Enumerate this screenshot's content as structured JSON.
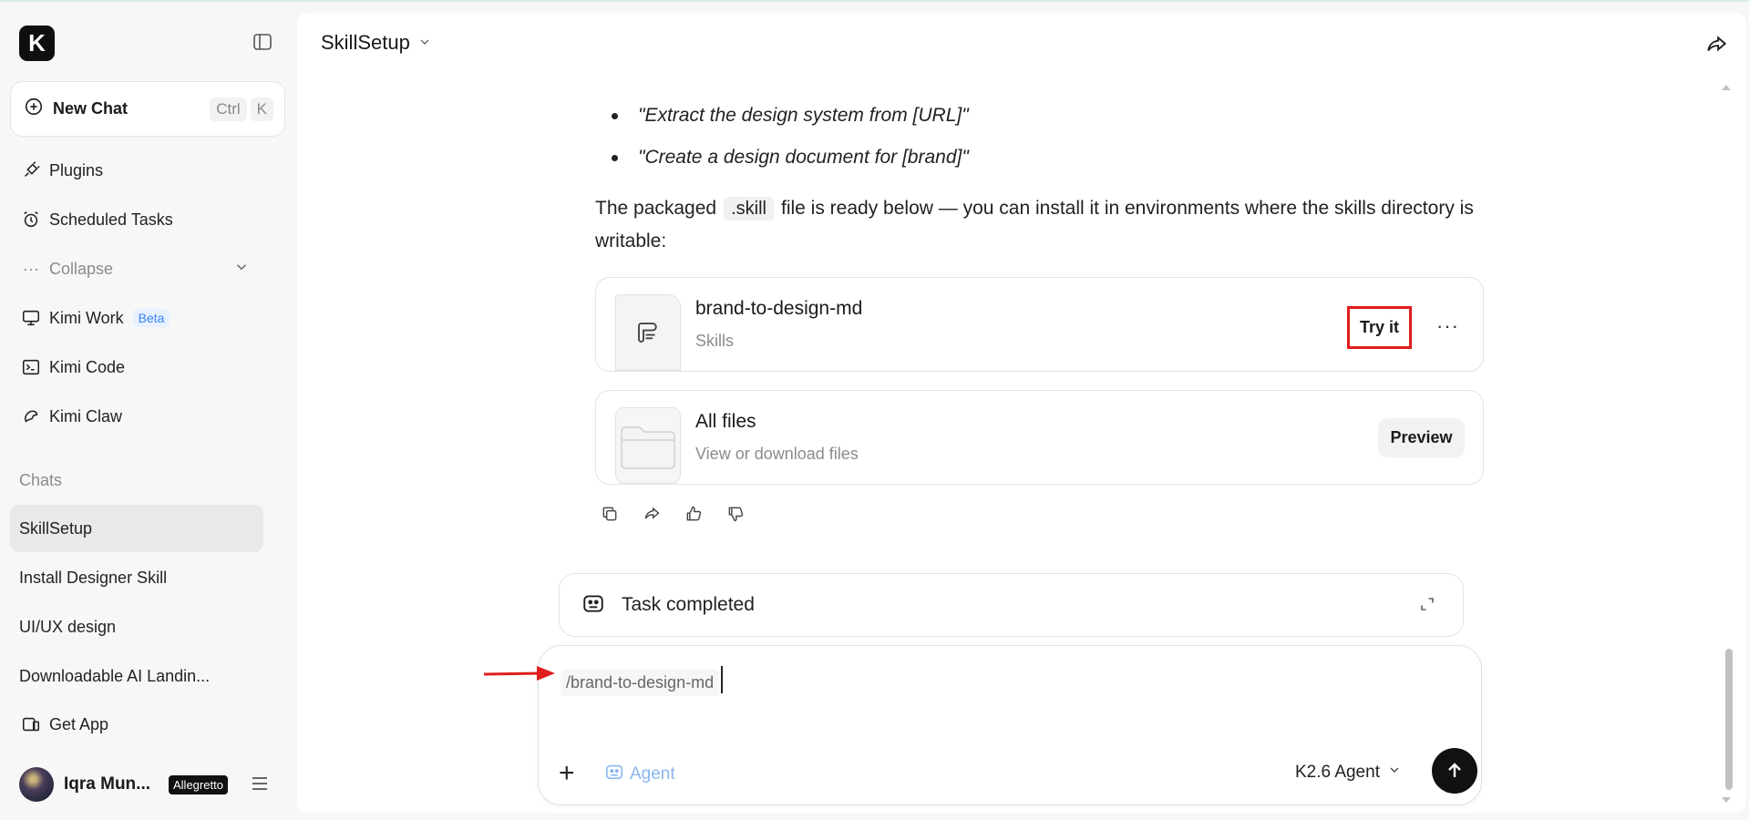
{
  "sidebar": {
    "logo_letter": "K",
    "new_chat": {
      "label": "New Chat",
      "shortcut": [
        "Ctrl",
        "K"
      ]
    },
    "nav": {
      "plugins": "Plugins",
      "scheduled_tasks": "Scheduled Tasks",
      "collapse": "Collapse",
      "kimi_work": "Kimi Work",
      "kimi_work_badge": "Beta",
      "kimi_code": "Kimi Code",
      "kimi_claw": "Kimi Claw"
    },
    "chats_label": "Chats",
    "chats": [
      "SkillSetup",
      "Install Designer Skill",
      "UI/UX design",
      "Downloadable AI Landin..."
    ],
    "get_app": "Get App",
    "user": {
      "name": "Iqra Mun...",
      "plan": "Allegretto"
    }
  },
  "main": {
    "title": "SkillSetup",
    "bullets": [
      "\"Extract the design system from [URL]\"",
      "\"Create a design document for [brand]\""
    ],
    "para_before": "The packaged",
    "para_code": ".skill",
    "para_after": "file is ready below — you can install it in environments where the skills directory is writable:",
    "skill_card": {
      "title": "brand-to-design-md",
      "subtitle": "Skills",
      "try_label": "Try it",
      "more": "···"
    },
    "files_card": {
      "title": "All files",
      "subtitle": "View or download files",
      "preview_label": "Preview"
    },
    "task_status": "Task completed",
    "input": {
      "command": "/brand-to-design-md",
      "agent_label": "Agent",
      "model": "K2.6 Agent"
    },
    "colors": {
      "accent_red": "#e11d1d",
      "agent_blue": "#8ab6f0"
    }
  }
}
